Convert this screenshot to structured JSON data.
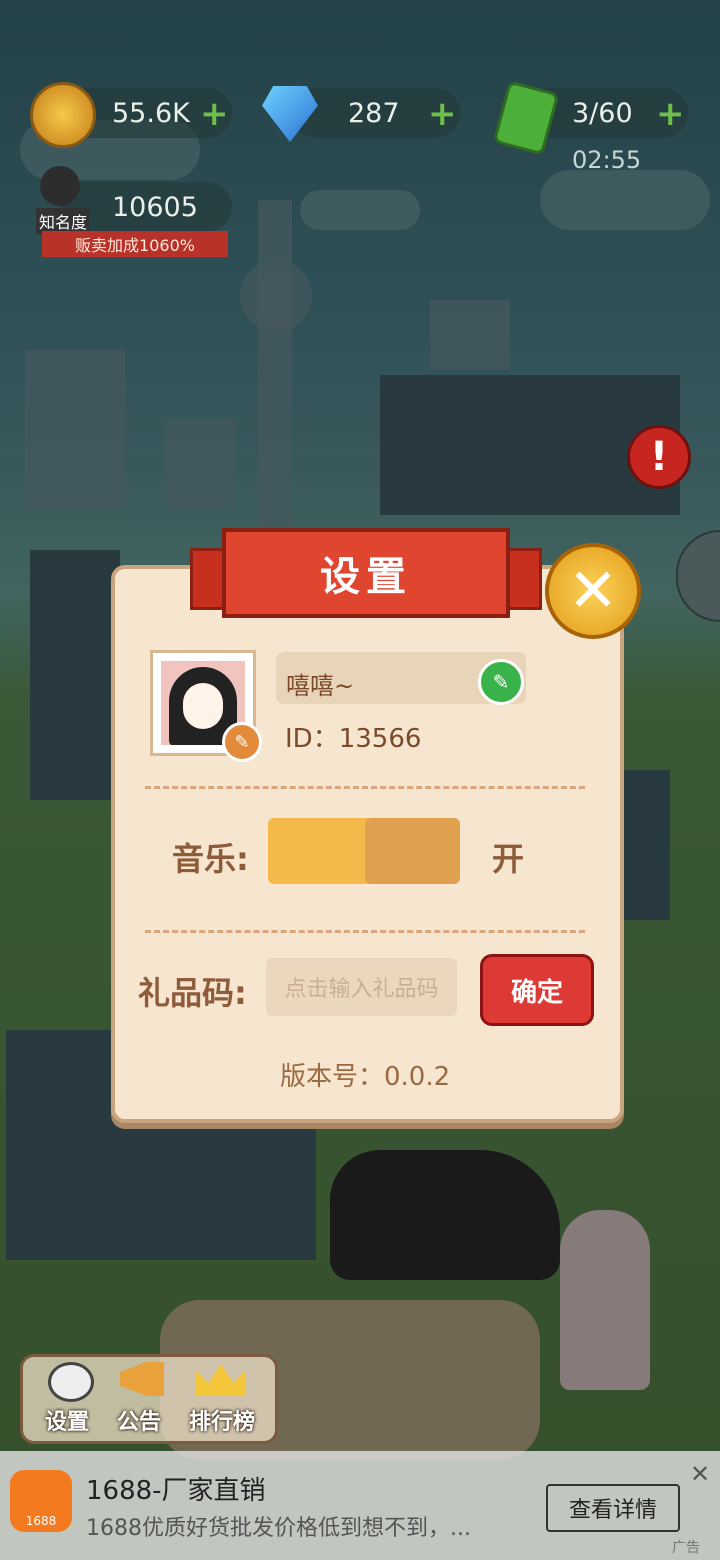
{
  "hud": {
    "gold": "55.6K",
    "gems": "287",
    "energy": "3/60",
    "energy_timer": "02:55",
    "fame_value": "10605",
    "fame_label": "知名度",
    "sell_bonus": "贩卖加成1060%"
  },
  "settings": {
    "title": "设置",
    "player_name": "嘻嘻~",
    "player_id": "ID：13566",
    "music_label": "音乐:",
    "music_state": "开",
    "gift_code_label": "礼品码:",
    "gift_code_placeholder": "点击输入礼品码",
    "confirm_label": "确定",
    "version": "版本号：0.0.2"
  },
  "bottom_menu": {
    "settings": "设置",
    "notice": "公告",
    "ranking": "排行榜"
  },
  "ad": {
    "title": "1688-厂家直销",
    "description": "1688优质好货批发价格低到想不到，...",
    "button": "查看详情",
    "tag": "广告"
  },
  "colors": {
    "panel": "#f6e6cf",
    "ribbon": "#e0452f",
    "confirm": "#dd3a36",
    "toggle": "#f5b84a"
  }
}
